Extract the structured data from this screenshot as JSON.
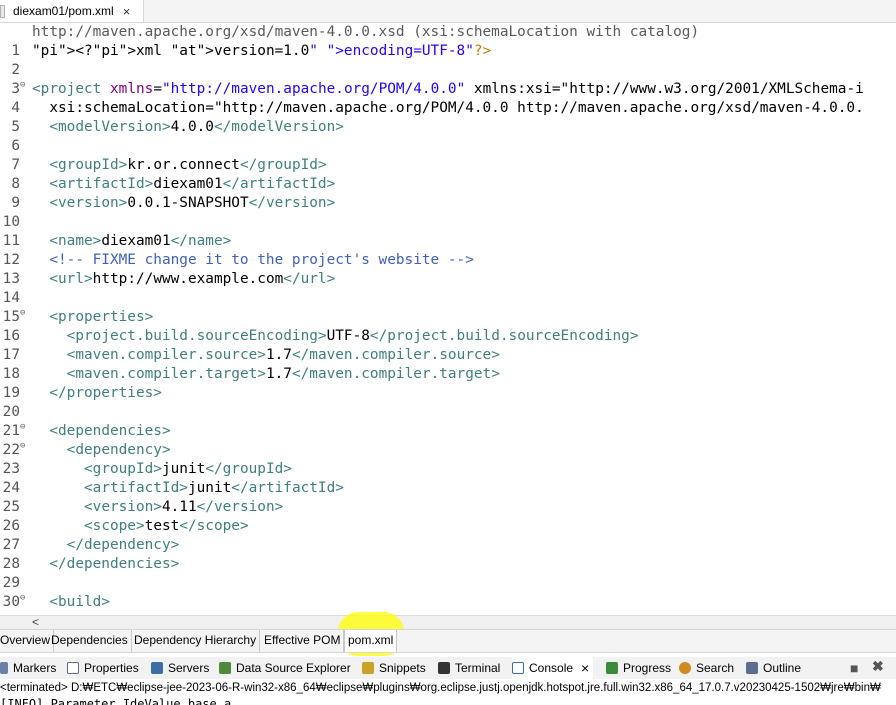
{
  "editor_tab": {
    "title": "diexam01/pom.xml",
    "close": "×"
  },
  "info_line": "http://maven.apache.org/xsd/maven-4.0.0.xsd (xsi:schemaLocation with catalog)",
  "lines": [
    {
      "n": "1",
      "text": "<?xml version=\"1.0\" encoding=\"UTF-8\"?>"
    },
    {
      "n": "2",
      "text": ""
    },
    {
      "n": "3",
      "text": "<project xmlns=\"http://maven.apache.org/POM/4.0.0\" xmlns:xsi=\"http://www.w3.org/2001/XMLSchema-i"
    },
    {
      "n": "4",
      "text": "  xsi:schemaLocation=\"http://maven.apache.org/POM/4.0.0 http://maven.apache.org/xsd/maven-4.0.0."
    },
    {
      "n": "5",
      "text": "  <modelVersion>4.0.0</modelVersion>"
    },
    {
      "n": "6",
      "text": ""
    },
    {
      "n": "7",
      "text": "  <groupId>kr.or.connect</groupId>"
    },
    {
      "n": "8",
      "text": "  <artifactId>diexam01</artifactId>"
    },
    {
      "n": "9",
      "text": "  <version>0.0.1-SNAPSHOT</version>"
    },
    {
      "n": "10",
      "text": ""
    },
    {
      "n": "11",
      "text": "  <name>diexam01</name>"
    },
    {
      "n": "12",
      "text": "  <!-- FIXME change it to the project's website -->"
    },
    {
      "n": "13",
      "text": "  <url>http://www.example.com</url>"
    },
    {
      "n": "14",
      "text": ""
    },
    {
      "n": "15",
      "text": "  <properties>"
    },
    {
      "n": "16",
      "text": "    <project.build.sourceEncoding>UTF-8</project.build.sourceEncoding>"
    },
    {
      "n": "17",
      "text": "    <maven.compiler.source>1.7</maven.compiler.source>"
    },
    {
      "n": "18",
      "text": "    <maven.compiler.target>1.7</maven.compiler.target>"
    },
    {
      "n": "19",
      "text": "  </properties>"
    },
    {
      "n": "20",
      "text": ""
    },
    {
      "n": "21",
      "text": "  <dependencies>"
    },
    {
      "n": "22",
      "text": "    <dependency>"
    },
    {
      "n": "23",
      "text": "      <groupId>junit</groupId>"
    },
    {
      "n": "24",
      "text": "      <artifactId>junit</artifactId>"
    },
    {
      "n": "25",
      "text": "      <version>4.11</version>"
    },
    {
      "n": "26",
      "text": "      <scope>test</scope>"
    },
    {
      "n": "27",
      "text": "    </dependency>"
    },
    {
      "n": "28",
      "text": "  </dependencies>"
    },
    {
      "n": "29",
      "text": ""
    },
    {
      "n": "30",
      "text": "  <build>"
    }
  ],
  "fold_marker": "⊖",
  "scroll_left": "<",
  "pom_tabs": [
    "Overview",
    "Dependencies",
    "Dependency Hierarchy",
    "Effective POM",
    "pom.xml"
  ],
  "view_tabs": [
    {
      "label": "Markers",
      "icon": "markers-icon",
      "color": "#6b7fa8"
    },
    {
      "label": "Properties",
      "icon": "properties-icon",
      "color": "#5c6b80"
    },
    {
      "label": "Servers",
      "icon": "servers-icon",
      "color": "#3b6ea5"
    },
    {
      "label": "Data Source Explorer",
      "icon": "data-source-icon",
      "color": "#4e8a3a"
    },
    {
      "label": "Snippets",
      "icon": "snippets-icon",
      "color": "#c9a227"
    },
    {
      "label": "Terminal",
      "icon": "terminal-icon",
      "color": "#333333"
    },
    {
      "label": "Console",
      "icon": "console-icon",
      "color": "#3b6ea5"
    },
    {
      "label": "Progress",
      "icon": "progress-icon",
      "color": "#3b8a3b"
    },
    {
      "label": "Search",
      "icon": "search-icon",
      "color": "#d08a20"
    },
    {
      "label": "Outline",
      "icon": "outline-icon",
      "color": "#5a6e8c"
    }
  ],
  "console_close": "×",
  "status_line": "<terminated> D:₩ETC₩eclipse-jee-2023-06-R-win32-x86_64₩eclipse₩plugins₩org.eclipse.justj.openjdk.hotspot.jre.full.win32.x86_64_17.0.7.v20230425-1502₩jre₩bin₩",
  "bottom_text": "[INFO] Parameter    IdeValue   base    a",
  "colors": {
    "accent": "#3f7f7f",
    "highlight": "#ffff00"
  }
}
